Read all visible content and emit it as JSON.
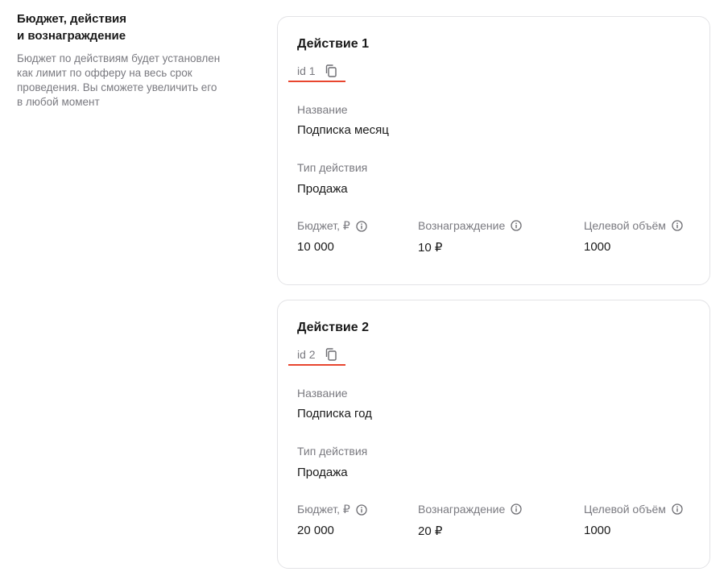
{
  "section": {
    "title": "Бюджет, действия\nи вознаграждение",
    "description": "Бюджет по действиям будет установлен\nкак лимит по офферу на весь срок\nпроведения. Вы сможете увеличить его\nв любой момент"
  },
  "actions": [
    {
      "title": "Действие 1",
      "id_label": "id 1",
      "name_label": "Название",
      "name_value": "Подписка месяц",
      "type_label": "Тип действия",
      "type_value": "Продажа",
      "budget_label": "Бюджет, ₽",
      "budget_value": "10 000",
      "reward_label": "Вознаграждение",
      "reward_value": "10 ₽",
      "volume_label": "Целевой объём",
      "volume_value": "1000"
    },
    {
      "title": "Действие 2",
      "id_label": "id 2",
      "name_label": "Название",
      "name_value": "Подписка год",
      "type_label": "Тип действия",
      "type_value": "Продажа",
      "budget_label": "Бюджет, ₽",
      "budget_value": "20 000",
      "reward_label": "Вознаграждение",
      "reward_value": "20 ₽",
      "volume_label": "Целевой объём",
      "volume_value": "1000"
    }
  ],
  "icons": {
    "copy": "copy-icon",
    "info": "info-circle-icon"
  },
  "colors": {
    "accent_underline": "#e8462f",
    "muted_text": "#7a7a80"
  }
}
